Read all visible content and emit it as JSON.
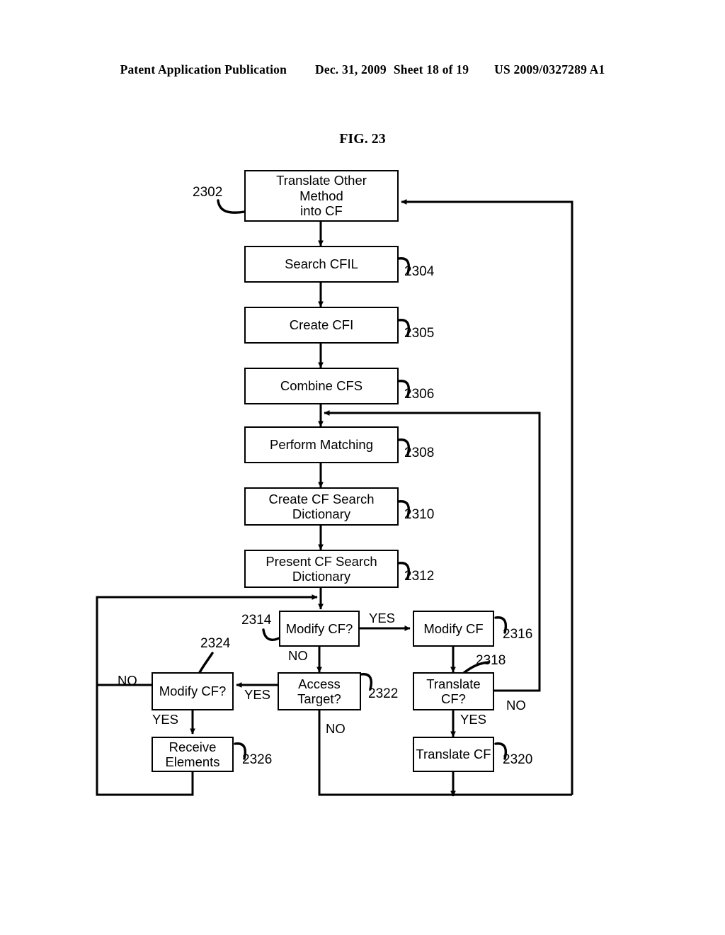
{
  "header": {
    "publication": "Patent Application Publication",
    "date": "Dec. 31, 2009",
    "sheet": "Sheet 18 of 19",
    "patent_number": "US 2009/0327289 A1"
  },
  "figure": {
    "title": "FIG. 23"
  },
  "boxes": [
    {
      "id": "2302",
      "label": "Translate Other\nMethod\ninto CF",
      "ref": "2302"
    },
    {
      "id": "2304",
      "label": "Search CFIL",
      "ref": "2304"
    },
    {
      "id": "2305",
      "label": "Create CFI",
      "ref": "2305"
    },
    {
      "id": "2306",
      "label": "Combine CFS",
      "ref": "2306"
    },
    {
      "id": "2308",
      "label": "Perform Matching",
      "ref": "2308"
    },
    {
      "id": "2310",
      "label": "Create CF Search\nDictionary",
      "ref": "2310"
    },
    {
      "id": "2312",
      "label": "Present CF Search\nDictionary",
      "ref": "2312"
    },
    {
      "id": "2314",
      "label": "Modify CF?",
      "ref": "2314"
    },
    {
      "id": "2316",
      "label": "Modify CF",
      "ref": "2316"
    },
    {
      "id": "2318",
      "label": "Translate\nCF?",
      "ref": "2318"
    },
    {
      "id": "2320",
      "label": "Translate CF",
      "ref": "2320"
    },
    {
      "id": "2322",
      "label": "Access\nTarget?",
      "ref": "2322"
    },
    {
      "id": "2324",
      "label": "Modify CF?",
      "ref": "2324"
    },
    {
      "id": "2326",
      "label": "Receive\nElements",
      "ref": "2326"
    }
  ],
  "edge_labels": {
    "l2314_yes": "YES",
    "l2314_no": "NO",
    "l2318_yes": "YES",
    "l2318_no": "NO",
    "l2322_yes": "YES",
    "l2322_no": "NO",
    "l2324_no": "NO",
    "l2324_yes": "YES"
  },
  "colors": {
    "ink": "#000000",
    "paper": "#ffffff"
  }
}
